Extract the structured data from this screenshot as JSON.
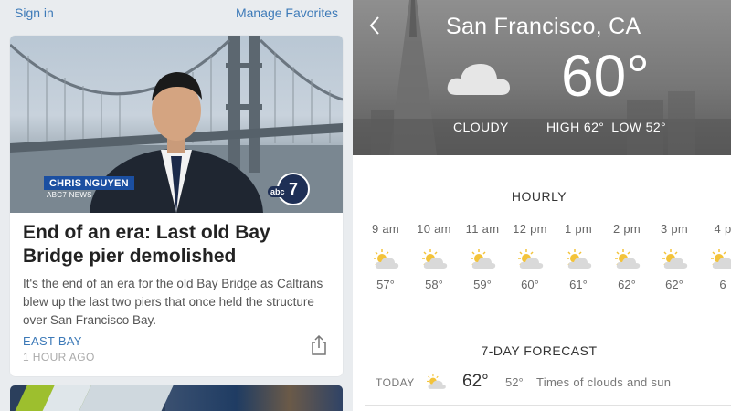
{
  "news": {
    "header": {
      "sign_in": "Sign in",
      "manage_favorites": "Manage Favorites"
    },
    "story": {
      "reporter_name": "CHRIS NGUYEN",
      "reporter_station": "ABC7 NEWS",
      "station_logo": "7",
      "station_logo_abc": "abc",
      "headline": "End of an era: Last old Bay Bridge pier demolished",
      "summary": "It's the end of an era for the old Bay Bridge as Caltrans blew up the last two piers that once held the structure over San Francisco Bay.",
      "category": "EAST BAY",
      "time_ago": "1 HOUR AGO",
      "share_icon": "share-icon"
    }
  },
  "weather": {
    "city": "San Francisco, CA",
    "current_temp": "60°",
    "condition": "CLOUDY",
    "high": "HIGH 62°",
    "low": "LOW 52°",
    "condition_icon": "cloud-icon",
    "hourly_title": "HOURLY",
    "hourly": [
      {
        "time": "9 am",
        "temp": "57°",
        "icon": "partly-sunny-icon"
      },
      {
        "time": "10 am",
        "temp": "58°",
        "icon": "partly-sunny-icon"
      },
      {
        "time": "11 am",
        "temp": "59°",
        "icon": "partly-sunny-icon"
      },
      {
        "time": "12 pm",
        "temp": "60°",
        "icon": "partly-sunny-icon"
      },
      {
        "time": "1 pm",
        "temp": "61°",
        "icon": "partly-sunny-icon"
      },
      {
        "time": "2 pm",
        "temp": "62°",
        "icon": "partly-sunny-icon"
      },
      {
        "time": "3 pm",
        "temp": "62°",
        "icon": "partly-sunny-icon"
      },
      {
        "time": "4 p",
        "temp": "6",
        "icon": "partly-sunny-icon"
      }
    ],
    "daily_title": "7-DAY FORECAST",
    "daily": [
      {
        "day": "TODAY",
        "high": "62°",
        "low": "52°",
        "desc": "Times of clouds and sun",
        "icon": "partly-sunny-icon"
      }
    ]
  },
  "colors": {
    "link_blue": "#3d7ab8",
    "lower_third_blue": "#1b4fa1",
    "sun_yellow": "#f3c33a"
  }
}
